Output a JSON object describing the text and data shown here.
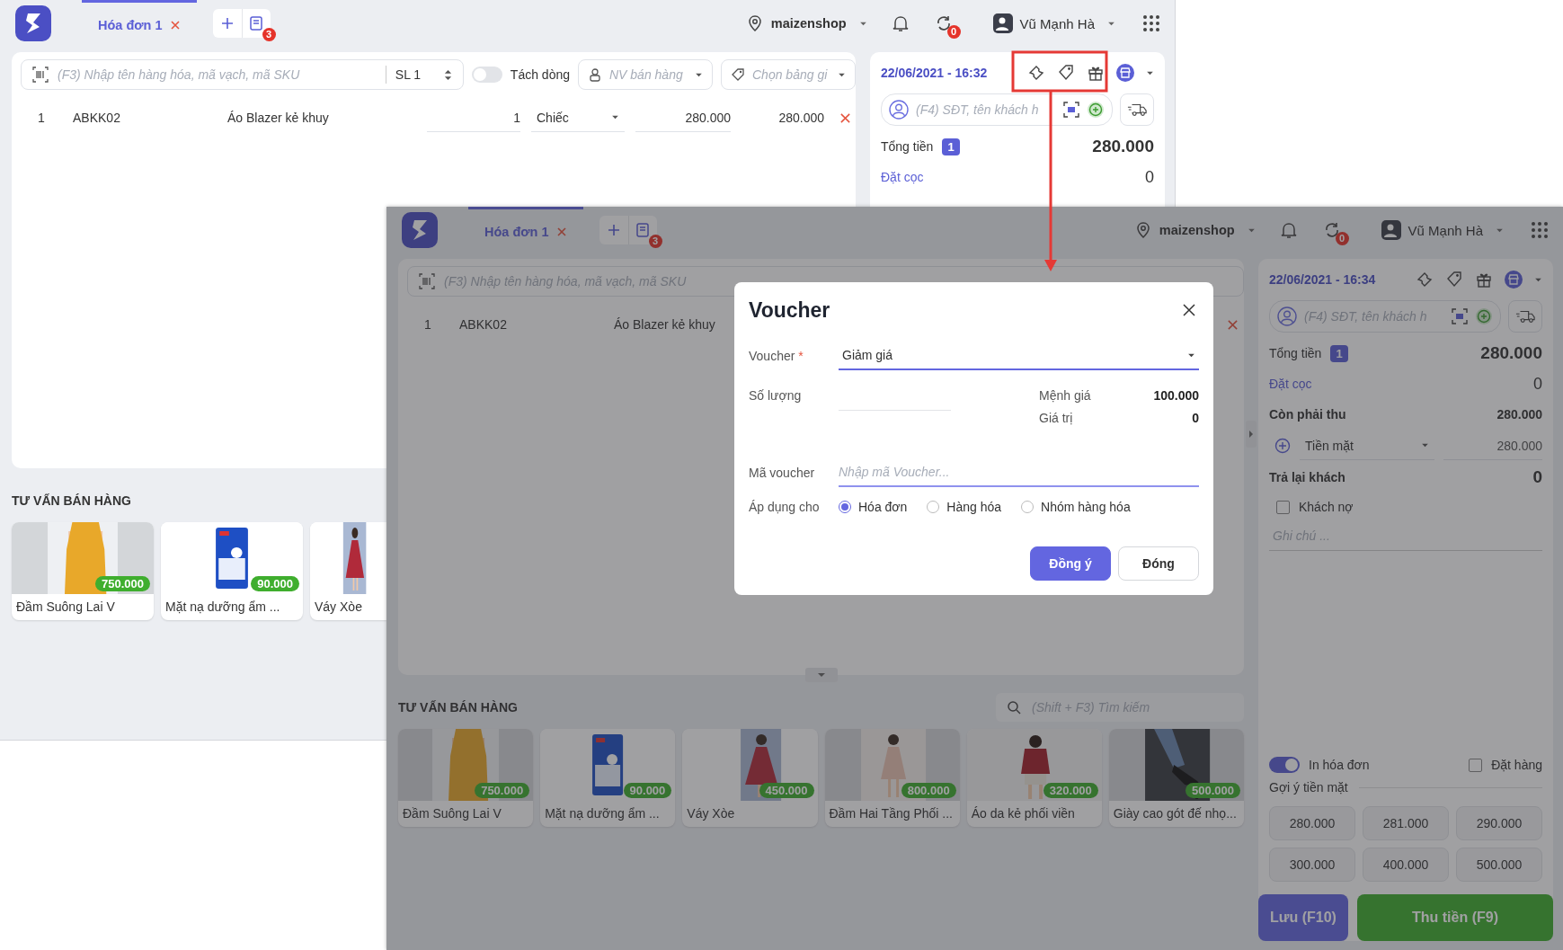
{
  "back_window": {
    "tabs": [
      {
        "label": "Hóa đơn 1",
        "selected": true
      }
    ],
    "invoice_count": "3",
    "store": "maizenshop",
    "sync_count": "0",
    "user": "Vũ Mạnh Hà",
    "search": {
      "placeholder": "(F3) Nhập tên hàng hóa, mã vạch, mã SKU",
      "quantity": "SL 1"
    },
    "split_lines": {
      "label": "Tách dòng",
      "on": false
    },
    "staff": {
      "placeholder": "NV bán hàng"
    },
    "price_list": {
      "placeholder": "Chọn bảng gi"
    },
    "lines": [
      {
        "index": "1",
        "code": "ABKK02",
        "name": "Áo Blazer kẻ khuy",
        "quantity": "1",
        "unit": "Chiếc",
        "price": "280.000",
        "total": "280.000"
      }
    ],
    "datetime": "22/06/2021 - 16:32",
    "customer": {
      "placeholder": "(F4) SĐT, tên khách h"
    },
    "summary": [
      {
        "kind": "total",
        "label": "Tổng tiền",
        "badge": "1",
        "value": "280.000"
      },
      {
        "kind": "link",
        "label": "Đặt cọc",
        "value": "0"
      }
    ],
    "suggest_title": "TƯ VẤN BÁN HÀNG",
    "products": [
      {
        "name": "Đầm Suông Lai V",
        "price": "750.000"
      },
      {
        "name": "Mặt nạ dưỡng ẩm ...",
        "price": "90.000"
      },
      {
        "name": "Váy Xòe"
      }
    ]
  },
  "front_window": {
    "tabs": [
      {
        "label": "Hóa đơn 1",
        "selected": true
      }
    ],
    "invoice_count": "3",
    "store": "maizenshop",
    "sync_count": "0",
    "user": "Vũ Mạnh Hà",
    "search": {
      "placeholder": "(F3) Nhập tên hàng hóa, mã vạch, mã SKU"
    },
    "lines": [
      {
        "index": "1",
        "code": "ABKK02",
        "name": "Áo Blazer kẻ khuy"
      }
    ],
    "datetime": "22/06/2021 - 16:34",
    "customer": {
      "placeholder": "(F4) SĐT, tên khách h"
    },
    "summary": [
      {
        "kind": "total",
        "label": "Tổng tiền",
        "badge": "1",
        "value": "280.000"
      },
      {
        "kind": "link",
        "label": "Đặt cọc",
        "value": "0"
      },
      {
        "kind": "due",
        "label": "Còn phải thu",
        "value": "280.000"
      }
    ],
    "payment": {
      "method": "Tiền mặt",
      "amount": "280.000"
    },
    "change": {
      "label": "Trả lại khách",
      "value": "0"
    },
    "debt": {
      "label": "Khách nợ",
      "checked": false
    },
    "note": {
      "placeholder": "Ghi chú ..."
    },
    "print_invoice": {
      "label": "In hóa đơn",
      "on": true
    },
    "order": {
      "label": "Đặt hàng",
      "checked": false
    },
    "cash_suggest_title": "Gợi ý tiền mặt",
    "cash_suggestions": [
      "280.000",
      "281.000",
      "290.000",
      "300.000",
      "400.000",
      "500.000"
    ],
    "save_button": "Lưu (F10)",
    "pay_button": "Thu tiền (F9)",
    "suggest_title": "TƯ VẤN BÁN HÀNG",
    "product_search": {
      "placeholder": "(Shift + F3) Tìm kiếm"
    },
    "products": [
      {
        "name": "Đầm Suông Lai V",
        "price": "750.000"
      },
      {
        "name": "Mặt nạ dưỡng ẩm ...",
        "price": "90.000"
      },
      {
        "name": "Váy Xòe",
        "price": "450.000"
      },
      {
        "name": "Đầm Hai Tầng Phối ...",
        "price": "800.000"
      },
      {
        "name": "Áo da kẻ phối viền",
        "price": "320.000"
      },
      {
        "name": "Giày cao gót đế nhọ...",
        "price": "500.000"
      }
    ]
  },
  "dialog": {
    "title": "Voucher",
    "voucher": {
      "label": "Voucher",
      "required_mark": "*",
      "value": "Giảm giá"
    },
    "quantity": {
      "label": "Số lượng"
    },
    "face_value": {
      "label": "Mệnh giá",
      "value": "100.000"
    },
    "worth": {
      "label": "Giá trị",
      "value": "0"
    },
    "code": {
      "label": "Mã voucher",
      "placeholder": "Nhập mã Voucher..."
    },
    "apply_to": {
      "label": "Áp dụng cho",
      "options": [
        {
          "label": "Hóa đơn",
          "selected": true
        },
        {
          "label": "Hàng hóa",
          "selected": false
        },
        {
          "label": "Nhóm hàng hóa",
          "selected": false
        }
      ]
    },
    "buttons": [
      {
        "label": "Đồng ý",
        "kind": "primary"
      },
      {
        "label": "Đóng",
        "kind": "secondary"
      }
    ]
  }
}
